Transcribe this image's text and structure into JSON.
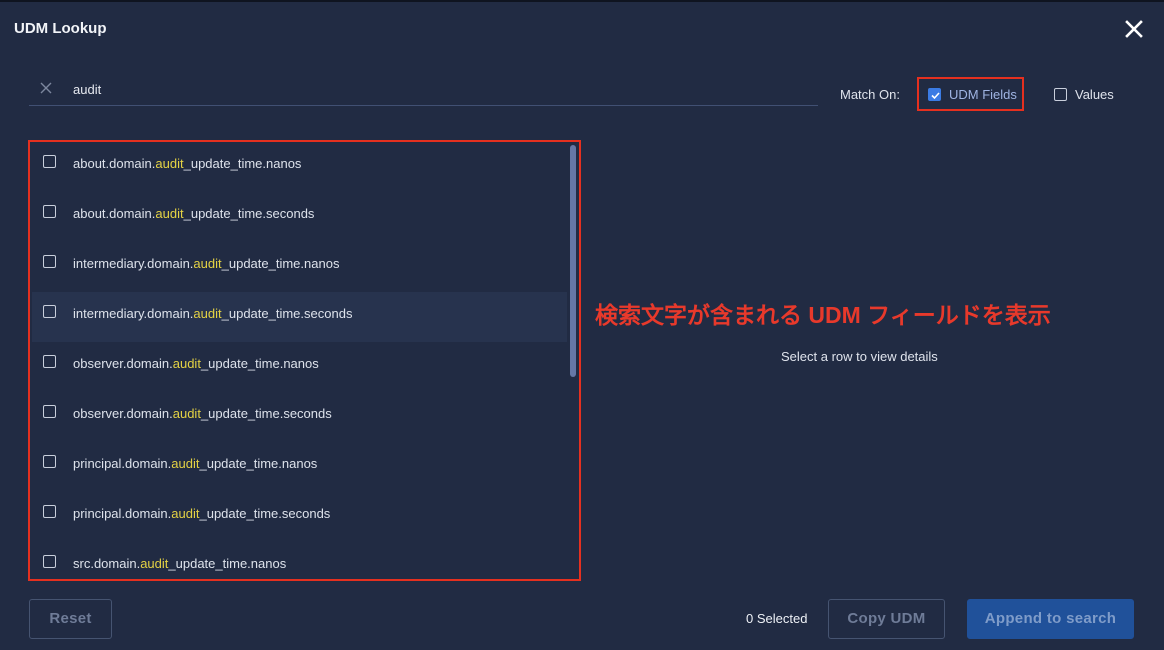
{
  "dialog": {
    "title": "UDM Lookup",
    "close_icon": "close-icon"
  },
  "search": {
    "value": "audit",
    "clear_icon": "clear-icon"
  },
  "match_on": {
    "label": "Match On:",
    "options": [
      {
        "label": "UDM Fields",
        "checked": true
      },
      {
        "label": "Values",
        "checked": false
      }
    ]
  },
  "results": {
    "highlight_term": "audit",
    "highlight_color": "#e4d244",
    "rows": [
      {
        "prefix": "about.domain.",
        "match": "audit",
        "suffix": "_update_time.nanos",
        "checked": false
      },
      {
        "prefix": "about.domain.",
        "match": "audit",
        "suffix": "_update_time.seconds",
        "checked": false
      },
      {
        "prefix": "intermediary.domain.",
        "match": "audit",
        "suffix": "_update_time.nanos",
        "checked": false
      },
      {
        "prefix": "intermediary.domain.",
        "match": "audit",
        "suffix": "_update_time.seconds",
        "checked": false,
        "hovered": true
      },
      {
        "prefix": "observer.domain.",
        "match": "audit",
        "suffix": "_update_time.nanos",
        "checked": false
      },
      {
        "prefix": "observer.domain.",
        "match": "audit",
        "suffix": "_update_time.seconds",
        "checked": false
      },
      {
        "prefix": "principal.domain.",
        "match": "audit",
        "suffix": "_update_time.nanos",
        "checked": false
      },
      {
        "prefix": "principal.domain.",
        "match": "audit",
        "suffix": "_update_time.seconds",
        "checked": false
      },
      {
        "prefix": "src.domain.",
        "match": "audit",
        "suffix": "_update_time.nanos",
        "checked": false
      }
    ]
  },
  "details": {
    "empty_message": "Select a row to view details"
  },
  "annotation": {
    "text": "検索文字が含まれる UDM フィールドを表示",
    "color": "#e8392b"
  },
  "footer": {
    "reset_label": "Reset",
    "selected_count": "0 Selected",
    "copy_label": "Copy UDM",
    "append_label": "Append to search"
  },
  "colors": {
    "background": "#212b43",
    "accent": "#3b7be4",
    "primary_button": "#20519a",
    "annotation_border": "#e5301f"
  }
}
